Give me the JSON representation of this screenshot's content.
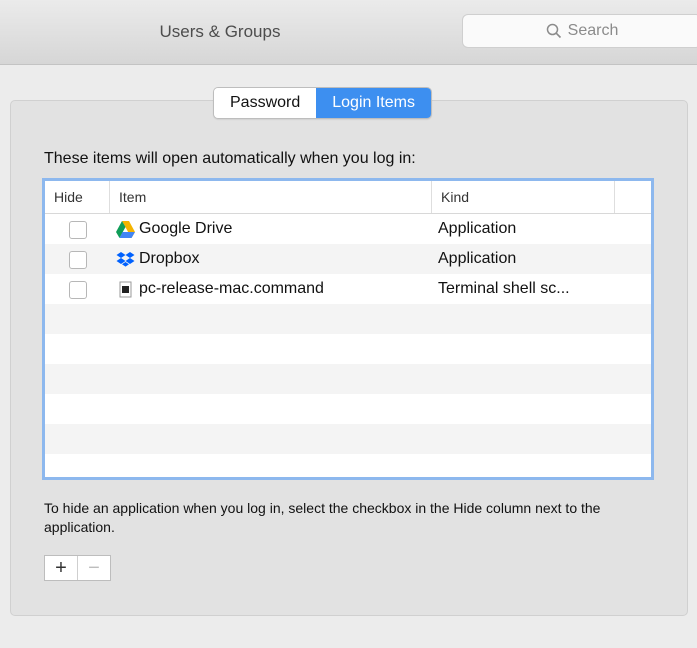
{
  "window": {
    "title": "Users & Groups"
  },
  "search": {
    "placeholder": "Search",
    "icon": "search-icon"
  },
  "tabs": [
    {
      "label": "Password",
      "active": false
    },
    {
      "label": "Login Items",
      "active": true
    }
  ],
  "description": "These items will open automatically when you log in:",
  "table": {
    "headers": {
      "hide": "Hide",
      "item": "Item",
      "kind": "Kind"
    },
    "rows": [
      {
        "hide": false,
        "name": "Google Drive",
        "icon": "google-drive-icon",
        "kind": "Application"
      },
      {
        "hide": false,
        "name": "Dropbox",
        "icon": "dropbox-icon",
        "kind": "Application"
      },
      {
        "hide": false,
        "name": "pc-release-mac.command",
        "icon": "terminal-file-icon",
        "kind": "Terminal shell sc..."
      }
    ]
  },
  "hint": "To hide an application when you log in, select the checkbox in the Hide column next to the application.",
  "buttons": {
    "add": "+",
    "remove": "−"
  },
  "colors": {
    "accent": "#3d8ff0",
    "focus_ring": "#8db8ee"
  }
}
